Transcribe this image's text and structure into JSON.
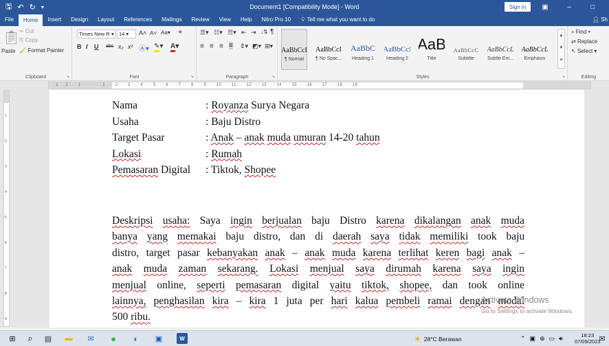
{
  "titlebar": {
    "title": "Document1 [Compatibility Mode] - Word",
    "sign_in": "Sign in",
    "icons": [
      "save-icon",
      "undo-icon",
      "redo-icon",
      "customize-icon"
    ]
  },
  "tabs": [
    "File",
    "Home",
    "Insert",
    "Design",
    "Layout",
    "References",
    "Mailings",
    "Review",
    "View",
    "Help",
    "Nitro Pro 10"
  ],
  "active_tab": "Home",
  "tell_me": "Tell me what you want to do",
  "share": "Sh",
  "ribbon": {
    "clipboard": {
      "paste": "Paste",
      "cut": "Cut",
      "copy": "Copy",
      "format_painter": "Format Painter",
      "label": "Clipboard"
    },
    "font": {
      "font_name": "Times New R",
      "font_size": "14",
      "label": "Font",
      "grow": "A˄",
      "shrink": "A˅",
      "case": "Aa",
      "bold": "B",
      "italic": "I",
      "underline": "U",
      "strike": "abc",
      "sub": "x₂",
      "sup": "x²"
    },
    "paragraph": {
      "label": "Paragraph"
    },
    "styles": {
      "label": "Styles",
      "items": [
        {
          "sample": "AaBbCcI",
          "name": "¶ Normal"
        },
        {
          "sample": "AaBbCcI",
          "name": "¶ No Spac..."
        },
        {
          "sample": "AaBbC",
          "name": "Heading 1"
        },
        {
          "sample": "AaBbCcI",
          "name": "Heading 2"
        },
        {
          "sample": "AaB",
          "name": "Title"
        },
        {
          "sample": "AaBbCcC",
          "name": "Subtitle"
        },
        {
          "sample": "AaBbCcL",
          "name": "Subtle Em..."
        },
        {
          "sample": "AaBbCcL",
          "name": "Emphasis"
        }
      ]
    },
    "editing": {
      "find": "Find",
      "replace": "Replace",
      "select": "Select",
      "label": "Editing"
    }
  },
  "ruler": {
    "text": "· 1 · · 2 · · · 1 · · · · · · · 1 · · · 2 · · · 3 · · · 4 · · · 5 · · · 6 · · · 7 · · · 8 · · · 9 · · · 10 · · · 11 · · · 12 · · · 13 · · · 14 · · · 15 · · · 16 · · · 17 · · · 18 · · · 19",
    "tab_selector": "L",
    "vertical_numbers": [
      "1",
      "2",
      "3",
      "4",
      "5",
      "6",
      "7",
      "8",
      "9"
    ]
  },
  "document": {
    "info": [
      {
        "key": "Nama",
        "value": ": Royanza Surya Negara"
      },
      {
        "key": "Usaha",
        "value": ": Baju Distro"
      },
      {
        "key": "Target Pasar",
        "value": ": Anak – anak muda umuran 14-20 tahun"
      },
      {
        "key": "Lokasi",
        "value": ": Rumah"
      },
      {
        "key": "Pemasaran Digital",
        "value": ": Tiktok, Shopee"
      }
    ],
    "description_lines": [
      "Deskripsi usaha: Saya ingin berjualan baju Distro karena dikalangan anak muda",
      "banya yang memakai baju distro, dan di daerah saya tidak memiliki took baju",
      "distro, target pasar kebanyakan anak – anak muda karena terlihat keren bagi anak –",
      "anak muda zaman sekarang. Lokasi menjual saya dirumah karena saya ingin",
      "menjual online, seperti pemasaran digital yaitu tiktok, shopee, dan took online",
      "lainnya, penghasilan kira – kira 1 juta per hari kalua pembeli ramai dengan modal",
      "500 ribu."
    ]
  },
  "watermark": {
    "line1": "Activate Windows",
    "line2": "Go to Settings to activate Windows."
  },
  "taskbar": {
    "icons": [
      "windows-start-icon",
      "search-icon",
      "task-view-icon",
      "file-explorer-icon",
      "mail-icon",
      "whatsapp-icon",
      "edge-icon",
      "store-icon",
      "word-icon"
    ],
    "weather": "28°C  Berawan",
    "time": "18:23",
    "date": "07/09/2023"
  },
  "colors": {
    "word_blue": "#2b579a",
    "spellcheck_red": "#d02020"
  }
}
